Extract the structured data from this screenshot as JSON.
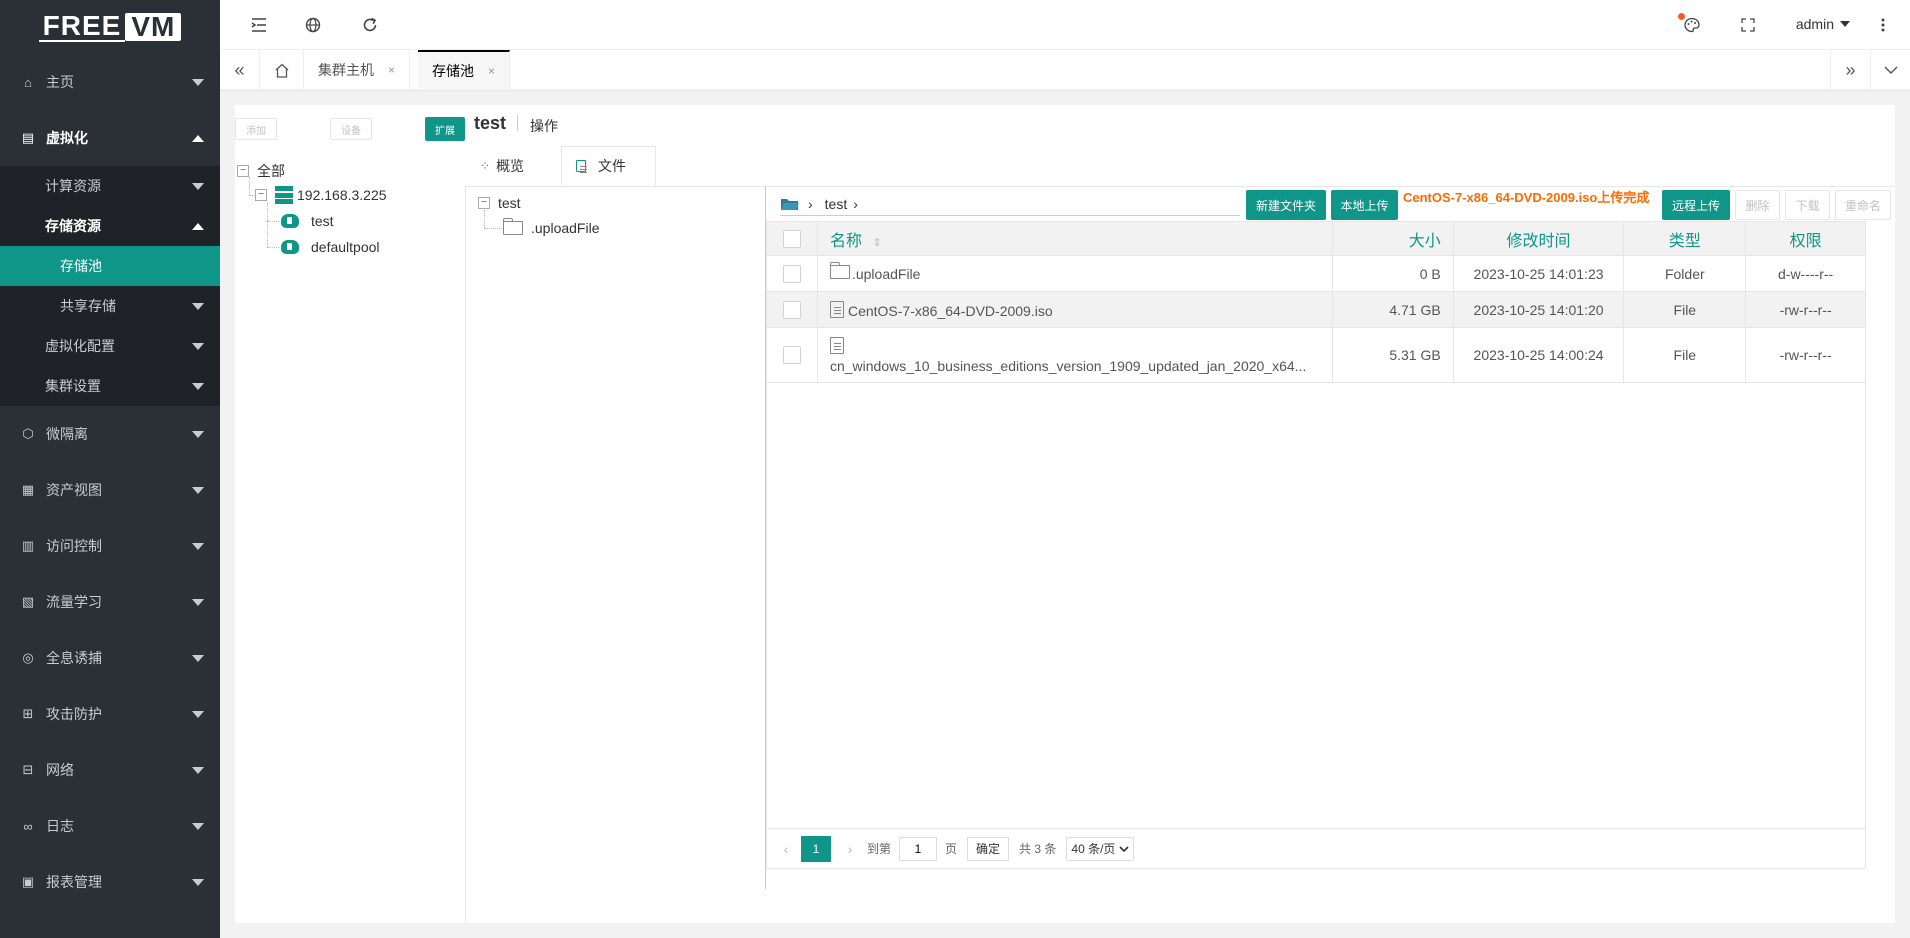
{
  "sidebar": {
    "logo_free": "FREE",
    "logo_vm": "VM",
    "home": "主页",
    "virtualization": "虚拟化",
    "compute": "计算资源",
    "storage": "存储资源",
    "storage_pool": "存储池",
    "shared_storage": "共享存储",
    "virt_config": "虚拟化配置",
    "cluster_settings": "集群设置",
    "micro_isolation": "微隔离",
    "asset_view": "资产视图",
    "access_control": "访问控制",
    "traffic_learning": "流量学习",
    "honeypot": "全息诱捕",
    "attack_defense": "攻击防护",
    "network": "网络",
    "logs": "日志",
    "reports": "报表管理"
  },
  "topbar": {
    "user": "admin"
  },
  "tabs": {
    "cluster_host": "集群主机",
    "storage_pool": "存储池",
    "close": "×"
  },
  "toolbar": {
    "add": "添加",
    "device": "设备",
    "expand": "扩展"
  },
  "tree": {
    "all": "全部",
    "host": "192.168.3.225",
    "pool1": "test",
    "pool2": "defaultpool"
  },
  "detail": {
    "title": "test",
    "operation": "操作",
    "tab_overview": "概览",
    "tab_files": "文件"
  },
  "file_tree": {
    "root": "test",
    "child": ".uploadFile"
  },
  "file_toolbar": {
    "path": "test",
    "new_folder": "新建文件夹",
    "local_upload": "本地上传",
    "upload_status": "CentOS-7-x86_64-DVD-2009.iso上传完成",
    "remote_upload": "远程上传",
    "delete": "删除",
    "download": "下载",
    "rename": "重命名"
  },
  "file_table": {
    "headers": {
      "name": "名称",
      "size": "大小",
      "mtime": "修改时间",
      "type": "类型",
      "perm": "权限"
    },
    "rows": [
      {
        "name": ".uploadFile",
        "size": "0 B",
        "mtime": "2023-10-25 14:01:23",
        "type": "Folder",
        "perm": "d-w----r--"
      },
      {
        "name": "CentOS-7-x86_64-DVD-2009.iso",
        "size": "4.71 GB",
        "mtime": "2023-10-25 14:01:20",
        "type": "File",
        "perm": "-rw-r--r--"
      },
      {
        "name": "cn_windows_10_business_editions_version_1909_updated_jan_2020_x64...",
        "size": "5.31 GB",
        "mtime": "2023-10-25 14:00:24",
        "type": "File",
        "perm": "-rw-r--r--"
      }
    ]
  },
  "pager": {
    "current": "1",
    "goto_label": "到第",
    "goto_value": "1",
    "page_unit": "页",
    "confirm": "确定",
    "total": "共 3 条",
    "page_size": "40 条/页"
  },
  "colors": {
    "accent": "#109688",
    "sidebar_bg": "#2b2f36",
    "upload_status": "#ff6a00"
  }
}
